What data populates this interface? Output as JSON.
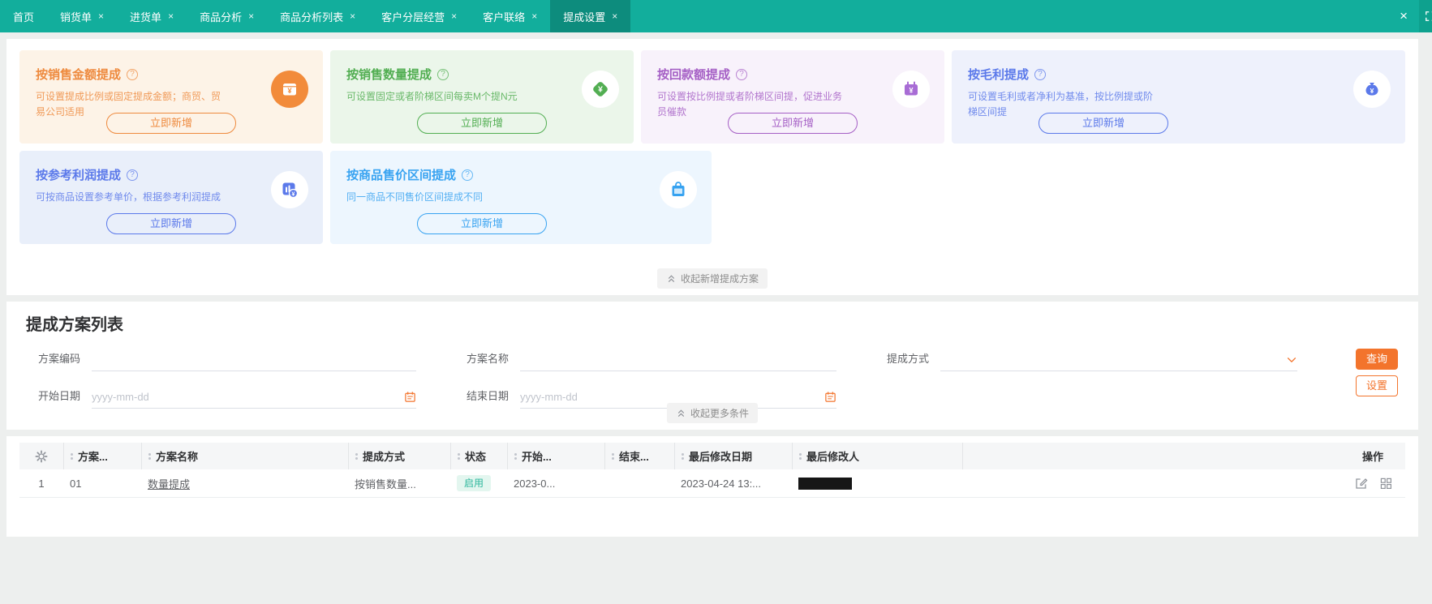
{
  "glyphs": {
    "help": "?",
    "close": "×"
  },
  "theme": {
    "navbar": "#12ae9c",
    "navbar_active": "#0d8c7d",
    "accent_orange": "#f3742c",
    "card_orange": "#ee8a3e",
    "card_green": "#52ae52",
    "card_purple": "#a55fc5",
    "card_indigo": "#5b79ea",
    "card_sky": "#38a3f1",
    "status_enabled_bg": "#e3f6ef",
    "status_enabled_text": "#2db79c"
  },
  "navbar": {
    "tabs": [
      {
        "label": "首页",
        "closable": false,
        "active": false
      },
      {
        "label": "销货单",
        "closable": true,
        "active": false
      },
      {
        "label": "进货单",
        "closable": true,
        "active": false
      },
      {
        "label": "商品分析",
        "closable": true,
        "active": false
      },
      {
        "label": "商品分析列表",
        "closable": true,
        "active": false
      },
      {
        "label": "客户分层经营",
        "closable": true,
        "active": false
      },
      {
        "label": "客户联络",
        "closable": true,
        "active": false
      },
      {
        "label": "提成设置",
        "closable": true,
        "active": true
      }
    ],
    "close_all_icon": "close-icon",
    "fullscreen_icon": "fullscreen-icon"
  },
  "cards": [
    {
      "title": "按销售金额提成",
      "desc": "可设置提成比例或固定提成金额；商贸、贸易公司适用",
      "button": "立即新增",
      "icon": "wallet-money-icon",
      "theme": "orange"
    },
    {
      "title": "按销售数量提成",
      "desc": "可设置固定或者阶梯区间每卖M个提N元",
      "button": "立即新增",
      "icon": "yuan-diamond-icon",
      "theme": "green"
    },
    {
      "title": "按回款额提成",
      "desc": "可设置按比例提或者阶梯区间提，促进业务员催款",
      "button": "立即新增",
      "icon": "purse-yuan-icon",
      "theme": "purple"
    },
    {
      "title": "按毛利提成",
      "desc": "可设置毛利或者净利为基准，按比例提或阶梯区间提",
      "button": "立即新增",
      "icon": "money-bag-icon",
      "theme": "indigo"
    },
    {
      "title": "按参考利润提成",
      "desc": "可按商品设置参考单价，根据参考利润提成",
      "button": "立即新增",
      "icon": "chart-coin-icon",
      "theme": "indigo"
    },
    {
      "title": "按商品售价区间提成",
      "desc": "同一商品不同售价区间提成不同",
      "button": "立即新增",
      "icon": "shopping-bag-icon",
      "theme": "sky"
    }
  ],
  "collapse_cards_label": "收起新增提成方案",
  "list_section": {
    "title": "提成方案列表",
    "filters": {
      "scheme_code_label": "方案编码",
      "scheme_name_label": "方案名称",
      "commission_type_label": "提成方式",
      "start_date_label": "开始日期",
      "end_date_label": "结束日期",
      "date_placeholder": "yyyy-mm-dd",
      "query_button": "查询",
      "settings_button": "设置"
    },
    "collapse_more_label": "收起更多条件"
  },
  "table": {
    "headers": {
      "scheme_code": "方案...",
      "scheme_name": "方案名称",
      "commission_type": "提成方式",
      "status": "状态",
      "start": "开始...",
      "end": "结束...",
      "last_modified_date": "最后修改日期",
      "last_modified_by": "最后修改人",
      "actions": "操作"
    },
    "rows": [
      {
        "index": "1",
        "scheme_code": "01",
        "scheme_name": "数量提成",
        "commission_type": "按销售数量...",
        "status": "启用",
        "start": "2023-0...",
        "end": "",
        "last_modified_date": "2023-04-24 13:...",
        "last_modified_by_redacted": true
      }
    ]
  }
}
